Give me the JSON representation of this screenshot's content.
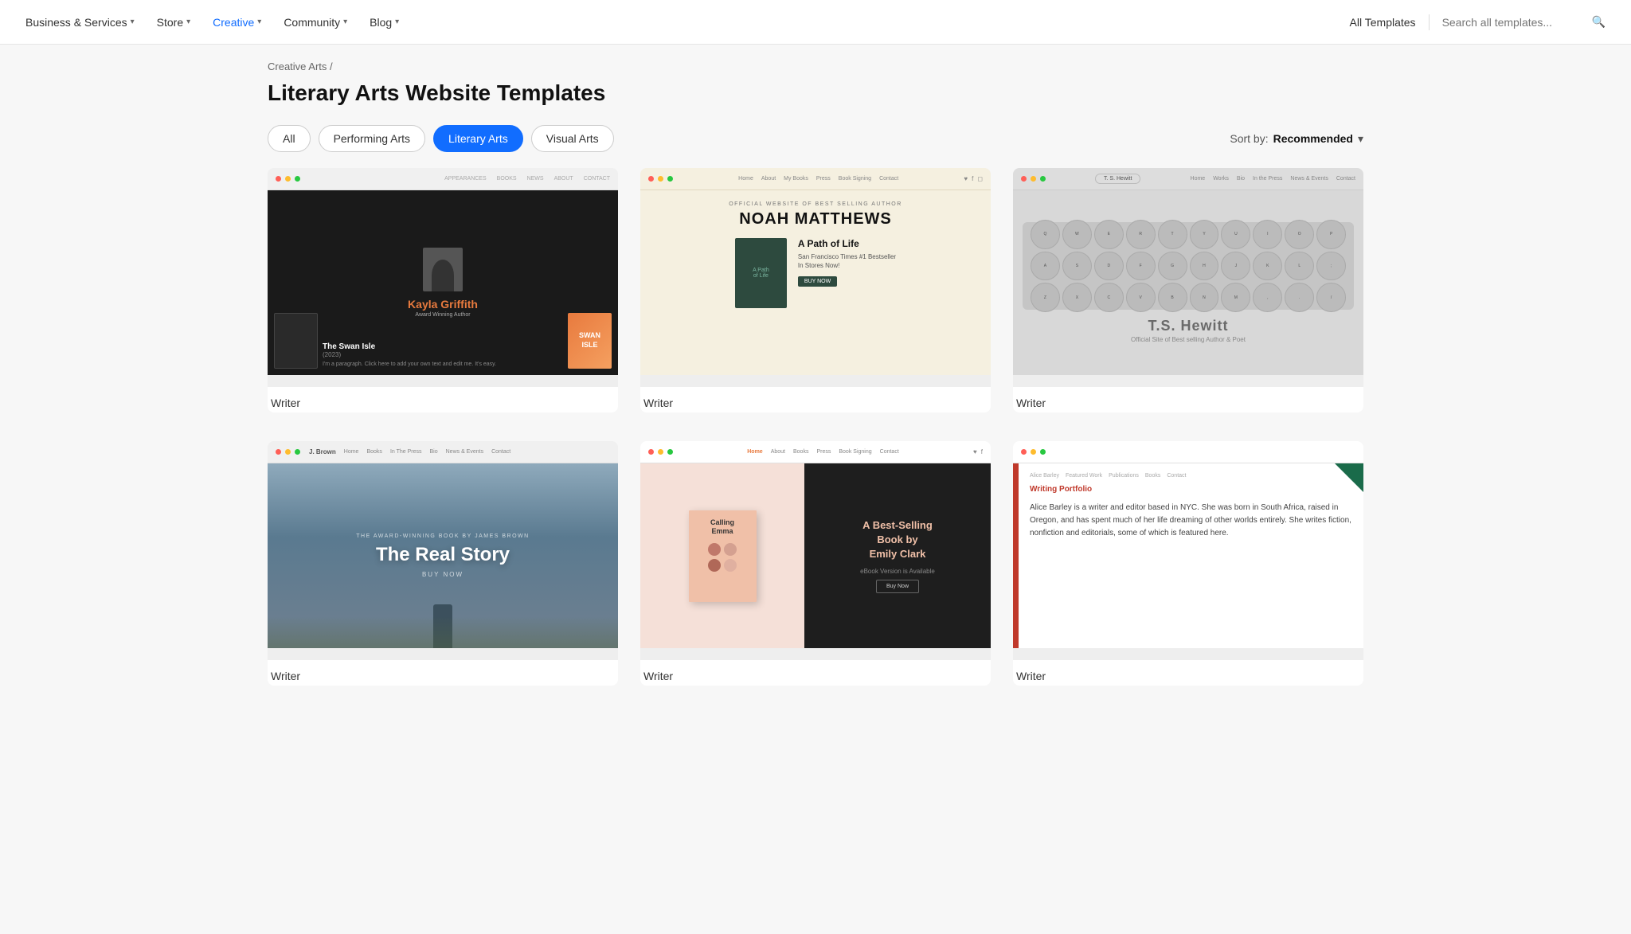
{
  "nav": {
    "items": [
      {
        "label": "Business & Services",
        "active": false,
        "hasDropdown": true
      },
      {
        "label": "Store",
        "active": false,
        "hasDropdown": true
      },
      {
        "label": "Creative",
        "active": true,
        "hasDropdown": true
      },
      {
        "label": "Community",
        "active": false,
        "hasDropdown": true
      },
      {
        "label": "Blog",
        "active": false,
        "hasDropdown": true
      }
    ],
    "all_templates": "All Templates",
    "search_placeholder": "Search all templates..."
  },
  "breadcrumb": {
    "parent": "Creative Arts",
    "separator": "/"
  },
  "page": {
    "title": "Literary Arts Website Templates",
    "sort_label": "Sort by:",
    "sort_value": "Recommended"
  },
  "filters": [
    {
      "label": "All",
      "selected": false
    },
    {
      "label": "Performing Arts",
      "selected": false
    },
    {
      "label": "Literary Arts",
      "selected": true
    },
    {
      "label": "Visual Arts",
      "selected": false
    }
  ],
  "templates": [
    {
      "id": 1,
      "label": "Writer",
      "category": "author-dark"
    },
    {
      "id": 2,
      "label": "Writer",
      "category": "author-beige"
    },
    {
      "id": 3,
      "label": "Writer",
      "category": "typewriter"
    },
    {
      "id": 4,
      "label": "Writer",
      "category": "real-story"
    },
    {
      "id": 5,
      "label": "Writer",
      "category": "pink-book"
    },
    {
      "id": 6,
      "label": "Writer",
      "category": "portfolio"
    }
  ],
  "card1": {
    "nav_items": [
      "APPEARANCES",
      "BOOKS",
      "NEWS",
      "ABOUT",
      "CONTACT"
    ],
    "author": "Kayla Griffith",
    "tagline": "Award Winning Author",
    "book_title": "The Swan Isle",
    "book_year": "(2023)",
    "swan_text": "SWAN\nISLE"
  },
  "card2": {
    "official": "Official Website of Best Selling Author",
    "name": "NOAH MATTHEWS",
    "book_cover_text": "A Path of Life",
    "book_title": "A Path of Life",
    "book_subtitle": "San Francisco Times #1 Bestseller\nIn Stores Now!",
    "btn": "BUY NOW"
  },
  "card3": {
    "name": "T.S. Hewitt",
    "subtitle": "Official Site of Best selling\nAuthor & Poet",
    "keys": [
      "Q",
      "W",
      "E",
      "R",
      "T",
      "Y",
      "U",
      "I",
      "O",
      "P",
      "A",
      "S",
      "D",
      "F",
      "G",
      "H",
      "J",
      "K",
      "L",
      ";",
      "Z",
      "X",
      "C",
      "V",
      "B",
      "N",
      "M",
      ",",
      ".",
      "/"
    ]
  },
  "card4": {
    "tagline": "THE AWARD-WINNING BOOK BY JAMES BROWN",
    "title": "The Real Story",
    "buy": "BUY NOW",
    "nav_items": [
      "J. Brown",
      "Home",
      "Books",
      "In The Press",
      "Bio",
      "News & Events",
      "Contact"
    ]
  },
  "card5": {
    "book_title": "Calling\nEmma",
    "bestseller": "A Best-Selling\nBook by\nEmily Clark",
    "ebook": "eBook Version is Available",
    "btn": "Buy Now"
  },
  "card6": {
    "nav": "Alice Barley | Featured Work | Publications | Books | Contact",
    "heading": "Writing Portfolio",
    "bio": "Alice Barley is a writer and editor based in NYC. She was born in South Africa, raised in Oregon, and has spent much of her life dreaming of other worlds entirely. She writes fiction, nonfiction and editorials, some of which is featured here."
  }
}
